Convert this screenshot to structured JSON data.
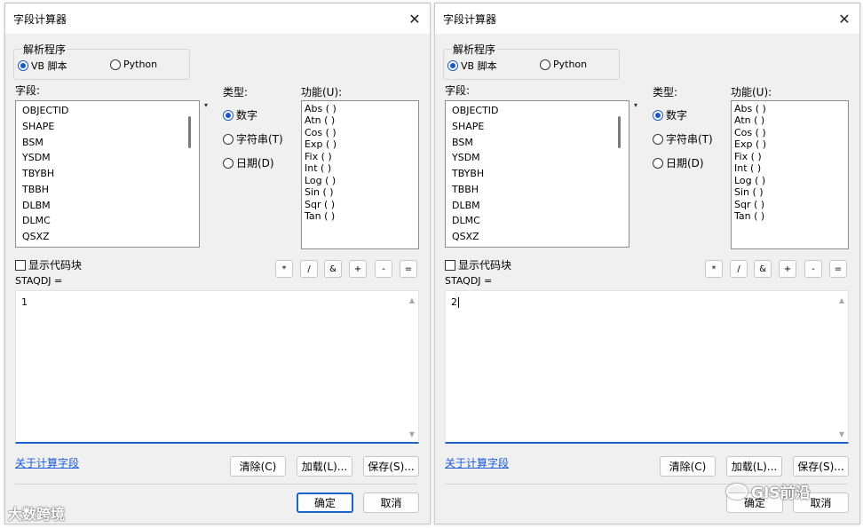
{
  "dialogs": [
    {
      "title": "字段计算器",
      "parser": {
        "legend": "解析程序",
        "vb": "VB 脚本",
        "python": "Python",
        "selected": "vb"
      },
      "fields_label": "字段:",
      "fields": [
        "OBJECTID",
        "SHAPE",
        "BSM",
        "YSDM",
        "TBYBH",
        "TBBH",
        "DLBM",
        "DLMC",
        "QSXZ"
      ],
      "type_label": "类型:",
      "types": [
        "数字",
        "字符串(T)",
        "日期(D)"
      ],
      "functions_label": "功能(U):",
      "functions": [
        "Abs ( )",
        "Atn ( )",
        "Cos ( )",
        "Exp ( )",
        "Fix ( )",
        "Int ( )",
        "Log ( )",
        "Sin ( )",
        "Sqr ( )",
        "Tan ( )"
      ],
      "show_codeblock": "显示代码块",
      "operators": [
        "*",
        "/",
        "&",
        "+",
        "-",
        "="
      ],
      "expression_label": "STAQDJ =",
      "expression": "1",
      "about_link": "关于计算字段",
      "clear_btn": "清除(C)",
      "load_btn": "加载(L)...",
      "save_btn": "保存(S)...",
      "ok_btn": "确定",
      "cancel_btn": "取消"
    },
    {
      "title": "字段计算器",
      "parser": {
        "legend": "解析程序",
        "vb": "VB 脚本",
        "python": "Python",
        "selected": "vb"
      },
      "fields_label": "字段:",
      "fields": [
        "OBJECTID",
        "SHAPE",
        "BSM",
        "YSDM",
        "TBYBH",
        "TBBH",
        "DLBM",
        "DLMC",
        "QSXZ"
      ],
      "type_label": "类型:",
      "types": [
        "数字",
        "字符串(T)",
        "日期(D)"
      ],
      "functions_label": "功能(U):",
      "functions": [
        "Abs ( )",
        "Atn ( )",
        "Cos ( )",
        "Exp ( )",
        "Fix ( )",
        "Int ( )",
        "Log ( )",
        "Sin ( )",
        "Sqr ( )",
        "Tan ( )"
      ],
      "show_codeblock": "显示代码块",
      "operators": [
        "*",
        "/",
        "&",
        "+",
        "-",
        "="
      ],
      "expression_label": "STAQDJ =",
      "expression": "2",
      "about_link": "关于计算字段",
      "clear_btn": "清除(C)",
      "load_btn": "加载(L)...",
      "save_btn": "保存(S)...",
      "ok_btn": "确定",
      "cancel_btn": "取消"
    }
  ],
  "icons": {
    "close": "close-icon",
    "scroll_up": "scroll-up-icon",
    "scroll_down": "scroll-down-icon"
  },
  "watermarks": {
    "left": "大数跨境",
    "right": "GIS前沿"
  },
  "colors": {
    "accent": "#1b63c9",
    "link": "#1a5adb"
  }
}
